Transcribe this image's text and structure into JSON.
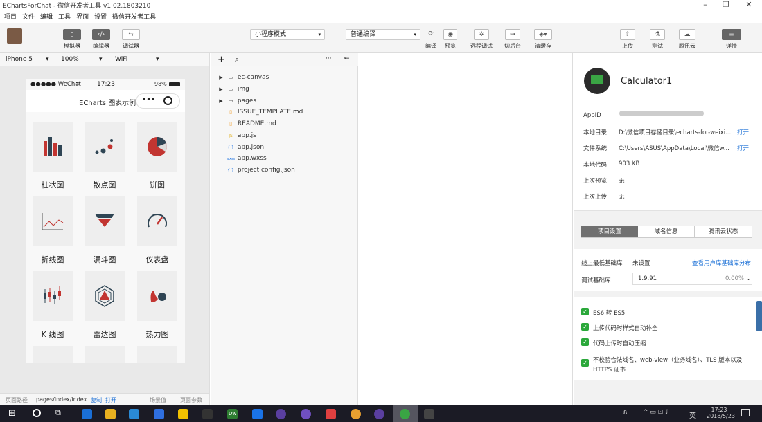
{
  "window": {
    "title": "EChartsForChat - 微信开发者工具 v1.02.1803210",
    "min": "–",
    "max": "❐",
    "close": "✕"
  },
  "menu": [
    "项目",
    "文件",
    "编辑",
    "工具",
    "界面",
    "设置",
    "微信开发者工具"
  ],
  "toolbar": {
    "simulator": "模拟器",
    "editor": "编辑器",
    "debugger": "调试器",
    "mode": "小程序模式",
    "compile_mode": "普通编译",
    "compile": "编译",
    "preview": "预览",
    "remote_debug": "远程调试",
    "background": "切后台",
    "clear_cache": "清缓存",
    "upload": "上传",
    "test": "测试",
    "tencent_cloud": "腾讯云",
    "details": "详情"
  },
  "device": {
    "model": "iPhone 5",
    "zoom": "100%",
    "network": "WiFi"
  },
  "phone": {
    "carrier": "●●●●● WeChat",
    "time": "17:23",
    "battery": "98%",
    "nav_title": "ECharts 图表示例",
    "charts": [
      "柱状图",
      "散点图",
      "饼图",
      "折线图",
      "漏斗图",
      "仪表盘",
      "K 线图",
      "雷达图",
      "热力图"
    ]
  },
  "sim_footer": {
    "path_label": "页面路径",
    "path": "pages/index/index",
    "copy": "复制",
    "open": "打开",
    "scene": "场景值",
    "params": "页面参数"
  },
  "files": {
    "add": "+",
    "search": "⌕",
    "more": "···",
    "collapse": "⇤",
    "items": [
      {
        "name": "ec-canvas",
        "type": "folder"
      },
      {
        "name": "img",
        "type": "folder"
      },
      {
        "name": "pages",
        "type": "folder"
      },
      {
        "name": "ISSUE_TEMPLATE.md",
        "type": "md"
      },
      {
        "name": "README.md",
        "type": "md"
      },
      {
        "name": "app.js",
        "type": "js",
        "badge": "JS"
      },
      {
        "name": "app.json",
        "type": "json",
        "badge": "{ }"
      },
      {
        "name": "app.wxss",
        "type": "wxss",
        "badge": "wxss"
      },
      {
        "name": "project.config.json",
        "type": "json",
        "badge": "{ }"
      }
    ]
  },
  "details": {
    "project_name": "Calculator1",
    "appid_label": "AppID",
    "local_dir_label": "本地目录",
    "local_dir": "D:\\微信项目存储目录\\echarts-for-weixi...",
    "open1": "打开",
    "fs_label": "文件系统",
    "fs": "C:\\Users\\ASUS\\AppData\\Local\\微信w...",
    "open2": "打开",
    "code_label": "本地代码",
    "code_size": "903 KB",
    "last_preview_label": "上次预览",
    "last_preview": "无",
    "last_upload_label": "上次上传",
    "last_upload": "无",
    "tabs": [
      "项目设置",
      "域名信息",
      "腾讯云状态"
    ],
    "min_lib_label": "线上最低基础库",
    "min_lib": "未设置",
    "view_dist": "查看用户库基础库分布",
    "debug_lib_label": "调试基础库",
    "debug_lib": "1.9.91",
    "debug_pct": "0.00%",
    "options": [
      "ES6 转 ES5",
      "上传代码时样式自动补全",
      "代码上传时自动压缩",
      "不校验合法域名、web-view（业务域名）、TLS 版本以及 HTTPS 证书"
    ]
  },
  "taskbar": {
    "lang": "英",
    "time": "17:23",
    "date": "2018/5/23",
    "dw": "Dw"
  }
}
